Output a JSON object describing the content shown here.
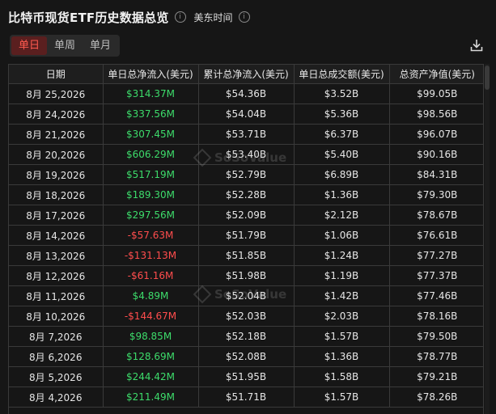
{
  "header": {
    "title": "比特币现货ETF历史数据总览",
    "info_symbol": "i",
    "timezone": "美东时间"
  },
  "tabs": [
    {
      "label": "单日",
      "active": true
    },
    {
      "label": "单周",
      "active": false
    },
    {
      "label": "单月",
      "active": false
    }
  ],
  "toolbar": {
    "download_icon": "download-icon"
  },
  "watermark": {
    "text": "SoSoValue"
  },
  "table": {
    "columns": [
      "日期",
      "单日总净流入(美元)",
      "累计总净流入(美元)",
      "单日总成交额(美元)",
      "总资产净值(美元)"
    ],
    "rows": [
      {
        "date": "8月 25,2026",
        "net_inflow": "$314.37M",
        "cum_inflow": "$54.36B",
        "volume": "$3.52B",
        "net_assets": "$99.05B",
        "sign": "pos"
      },
      {
        "date": "8月 24,2026",
        "net_inflow": "$337.56M",
        "cum_inflow": "$54.04B",
        "volume": "$5.36B",
        "net_assets": "$98.56B",
        "sign": "pos"
      },
      {
        "date": "8月 21,2026",
        "net_inflow": "$307.45M",
        "cum_inflow": "$53.71B",
        "volume": "$6.37B",
        "net_assets": "$96.07B",
        "sign": "pos"
      },
      {
        "date": "8月 20,2026",
        "net_inflow": "$606.29M",
        "cum_inflow": "$53.40B",
        "volume": "$5.40B",
        "net_assets": "$90.16B",
        "sign": "pos"
      },
      {
        "date": "8月 19,2026",
        "net_inflow": "$517.19M",
        "cum_inflow": "$52.79B",
        "volume": "$6.89B",
        "net_assets": "$84.31B",
        "sign": "pos"
      },
      {
        "date": "8月 18,2026",
        "net_inflow": "$189.30M",
        "cum_inflow": "$52.28B",
        "volume": "$1.36B",
        "net_assets": "$79.30B",
        "sign": "pos"
      },
      {
        "date": "8月 17,2026",
        "net_inflow": "$297.56M",
        "cum_inflow": "$52.09B",
        "volume": "$2.12B",
        "net_assets": "$78.67B",
        "sign": "pos"
      },
      {
        "date": "8月 14,2026",
        "net_inflow": "-$57.63M",
        "cum_inflow": "$51.79B",
        "volume": "$1.06B",
        "net_assets": "$76.61B",
        "sign": "neg"
      },
      {
        "date": "8月 13,2026",
        "net_inflow": "-$131.13M",
        "cum_inflow": "$51.85B",
        "volume": "$1.24B",
        "net_assets": "$77.27B",
        "sign": "neg"
      },
      {
        "date": "8月 12,2026",
        "net_inflow": "-$61.16M",
        "cum_inflow": "$51.98B",
        "volume": "$1.19B",
        "net_assets": "$77.37B",
        "sign": "neg"
      },
      {
        "date": "8月 11,2026",
        "net_inflow": "$4.89M",
        "cum_inflow": "$52.04B",
        "volume": "$1.42B",
        "net_assets": "$77.46B",
        "sign": "pos"
      },
      {
        "date": "8月 10,2026",
        "net_inflow": "-$144.67M",
        "cum_inflow": "$52.03B",
        "volume": "$2.03B",
        "net_assets": "$78.16B",
        "sign": "neg"
      },
      {
        "date": "8月 7,2026",
        "net_inflow": "$98.85M",
        "cum_inflow": "$52.18B",
        "volume": "$1.57B",
        "net_assets": "$79.50B",
        "sign": "pos"
      },
      {
        "date": "8月 6,2026",
        "net_inflow": "$128.69M",
        "cum_inflow": "$52.08B",
        "volume": "$1.36B",
        "net_assets": "$78.77B",
        "sign": "pos"
      },
      {
        "date": "8月 5,2026",
        "net_inflow": "$244.42M",
        "cum_inflow": "$51.95B",
        "volume": "$1.58B",
        "net_assets": "$79.21B",
        "sign": "pos"
      },
      {
        "date": "8月 4,2026",
        "net_inflow": "$211.49M",
        "cum_inflow": "$51.71B",
        "volume": "$1.57B",
        "net_assets": "$78.26B",
        "sign": "pos"
      }
    ]
  }
}
